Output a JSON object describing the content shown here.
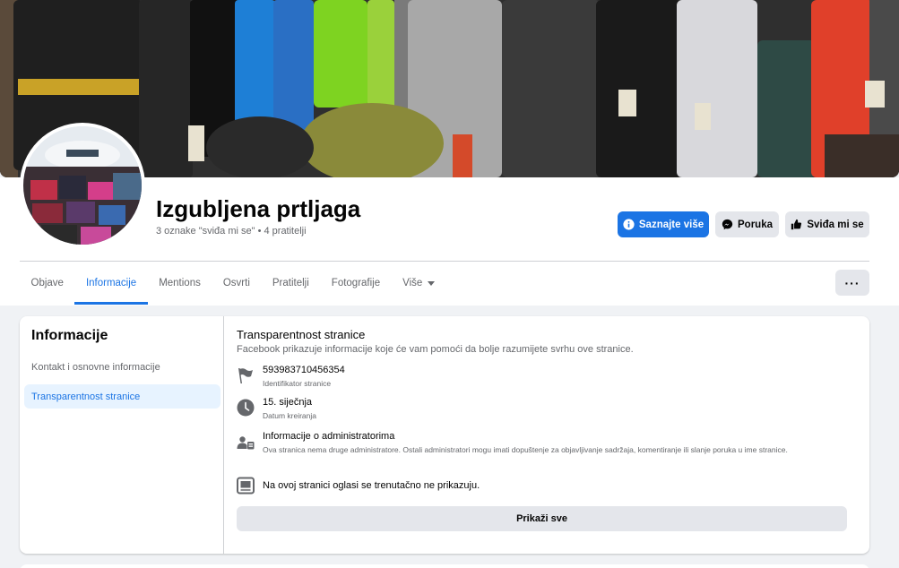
{
  "page": {
    "name": "Izgubljena prtljaga",
    "stats": "3 oznake \"sviđa mi se\" • 4 pratitelji"
  },
  "actions": {
    "learn_more": "Saznajte više",
    "message": "Poruka",
    "like": "Sviđa mi se"
  },
  "tabs": [
    {
      "label": "Objave"
    },
    {
      "label": "Informacije"
    },
    {
      "label": "Mentions"
    },
    {
      "label": "Osvrti"
    },
    {
      "label": "Pratitelji"
    },
    {
      "label": "Fotografije"
    },
    {
      "label": "Više"
    }
  ],
  "sidebar": {
    "title": "Informacije",
    "items": [
      {
        "label": "Kontakt i osnovne informacije"
      },
      {
        "label": "Transparentnost stranice"
      }
    ]
  },
  "transparency": {
    "title": "Transparentnost stranice",
    "description": "Facebook prikazuje informacije koje će vam pomoći da bolje razumijete svrhu ove stranice.",
    "rows": [
      {
        "icon": "flag-icon",
        "primary": "593983710456354",
        "secondary": "Identifikator stranice"
      },
      {
        "icon": "clock-icon",
        "primary": "15. siječnja",
        "secondary": "Datum kreiranja"
      },
      {
        "icon": "admins-icon",
        "primary": "Informacije o administratorima",
        "secondary": "Ova stranica nema druge administratore. Ostali administratori mogu imati dopuštenje za objavljivanje sadržaja, komentiranje ili slanje poruka u ime stranice."
      },
      {
        "icon": "ads-icon",
        "primary": "Na ovoj stranici oglasi se trenutačno ne prikazuju.",
        "secondary": ""
      }
    ],
    "show_all": "Prikaži sve"
  },
  "colors": {
    "accent": "#1b74e4",
    "background": "#f0f2f5",
    "secondary_text": "#65676b"
  }
}
